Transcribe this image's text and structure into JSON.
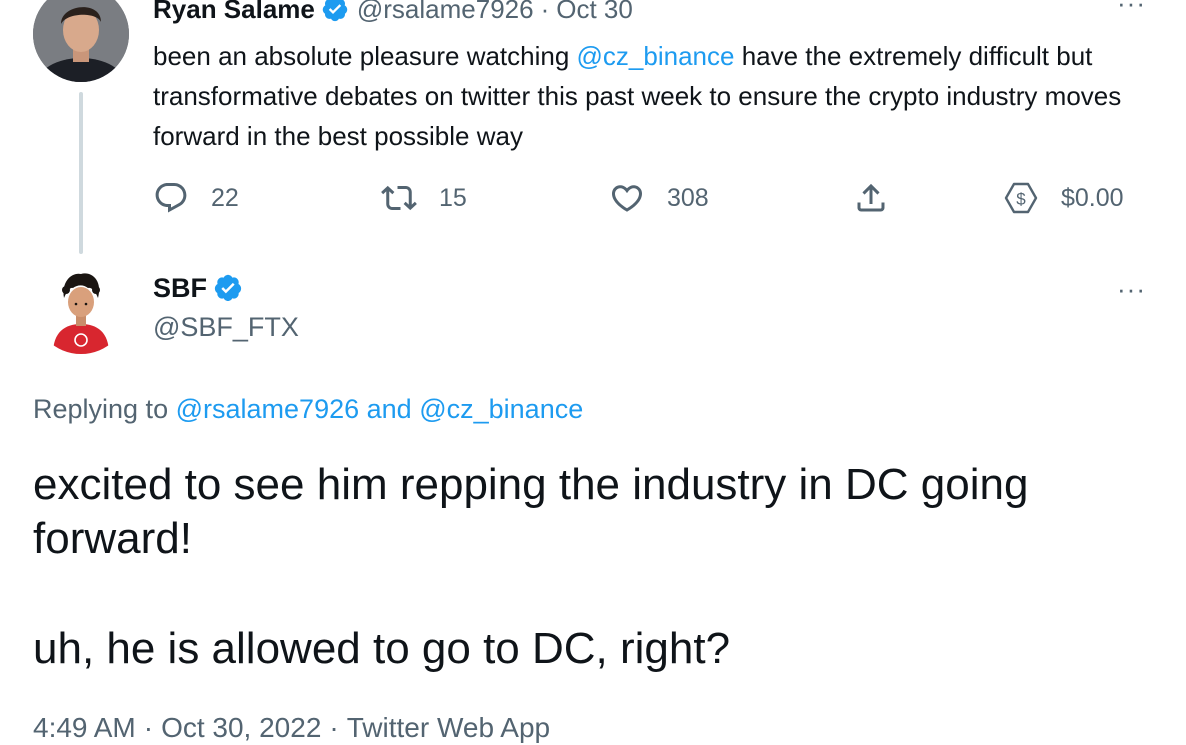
{
  "parent_tweet": {
    "author_name": "Ryan Salame",
    "author_handle": "@rsalame7926",
    "separator": "·",
    "date": "Oct 30",
    "text_segments": [
      {
        "text": "been an absolute pleasure watching ",
        "mention": false
      },
      {
        "text": "@cz_binance",
        "mention": true
      },
      {
        "text": " have the extremely difficult but transformative debates on twitter this past week to ensure the crypto industry moves forward in the best possible way",
        "mention": false
      }
    ],
    "actions": {
      "reply_count": "22",
      "retweet_count": "15",
      "like_count": "308",
      "tip_amount": "$0.00"
    },
    "more_menu": "···"
  },
  "main_tweet": {
    "author_name": "SBF",
    "author_handle": "@SBF_FTX",
    "more_menu": "···",
    "replying_prefix": "Replying to",
    "replying_to_1": "@rsalame7926",
    "replying_and": "and",
    "replying_to_2": "@cz_binance",
    "body_line_1": "excited to see him repping the industry in DC going forward!",
    "body_line_2": "uh, he is allowed to go to DC, right?",
    "time": "4:49 AM",
    "separator": "·",
    "date": "Oct 30, 2022",
    "source": "Twitter Web App"
  },
  "colors": {
    "text": "#0f1419",
    "secondary": "#536471",
    "accent": "#1d9bf0",
    "thread_line": "#cfd9de"
  },
  "icons": {
    "verified": "verified-badge-icon",
    "reply": "reply-icon",
    "retweet": "retweet-icon",
    "like": "heart-icon",
    "share": "share-icon",
    "tip": "tip-dollar-icon",
    "more": "more-dots-icon"
  }
}
